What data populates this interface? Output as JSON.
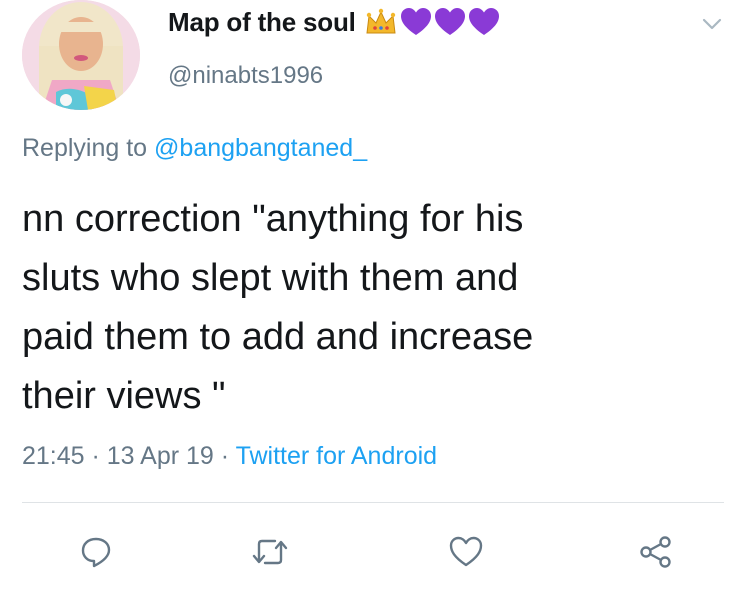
{
  "tweet": {
    "display_name": "Map of the soul",
    "name_emoji": [
      "crown",
      "purple-heart",
      "purple-heart",
      "purple-heart"
    ],
    "handle": "@ninabts1996",
    "replying_prefix": "Replying to",
    "replying_to": "@bangbangtaned_",
    "text": "nn correction \"anything for his\nsluts who slept with them and\npaid them to add and increase\ntheir  views \"",
    "time": "21:45",
    "separator1": " · ",
    "date": "13 Apr 19",
    "separator2": " · ",
    "source": "Twitter for Android"
  },
  "actions": [
    {
      "name": "reply",
      "icon": "reply-icon"
    },
    {
      "name": "retweet",
      "icon": "retweet-icon"
    },
    {
      "name": "like",
      "icon": "heart-icon"
    },
    {
      "name": "share",
      "icon": "share-icon"
    }
  ],
  "colors": {
    "text_primary": "#14171a",
    "text_secondary": "#657786",
    "link": "#1da1f2",
    "heart": "#8a3ad6",
    "divider": "#dfe3e6"
  }
}
